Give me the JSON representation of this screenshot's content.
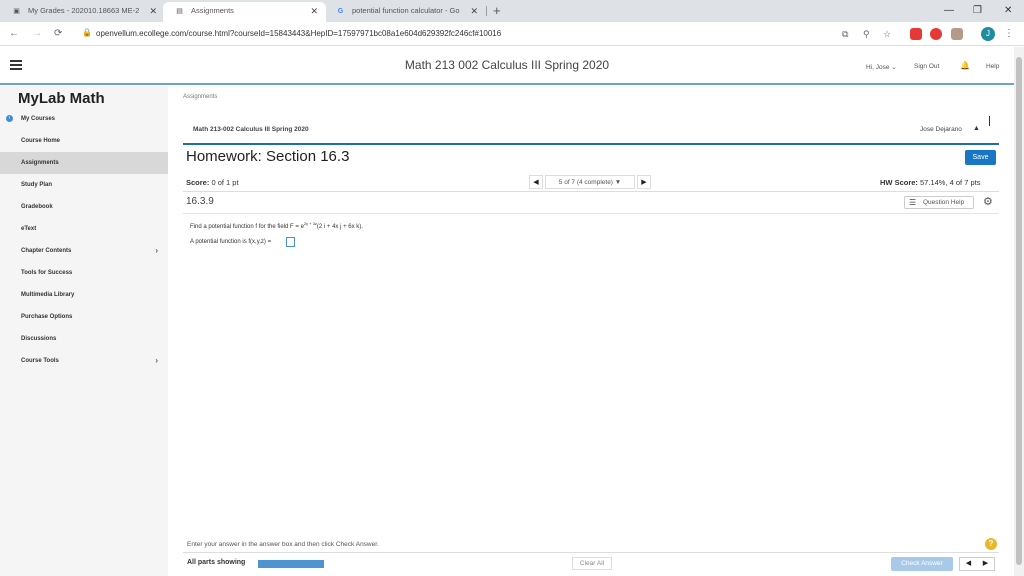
{
  "browser": {
    "tabs": [
      {
        "title": "My Grades - 202010.18663 ME-2",
        "icon": "mygrades-favicon",
        "active": false
      },
      {
        "title": "Assignments",
        "icon": "document-favicon",
        "active": true
      },
      {
        "title": "potential function calculator - Go",
        "icon": "google-favicon",
        "active": false
      }
    ],
    "favicon_glyphs": [
      "▣",
      "▤",
      "G"
    ],
    "close_glyph": "✕",
    "new_tab_glyph": "+",
    "window_controls": [
      "—",
      "❐",
      "✕"
    ],
    "url": "openvellum.ecollege.com/course.html?courseId=15843443&HepID=17597971bc08a1e604d629392fc246cf#10016",
    "nav_glyphs": {
      "back": "←",
      "forward": "→",
      "reload": "⟳",
      "lock": "🔒"
    },
    "addr_icons": [
      "⧉",
      "⚲",
      "☆"
    ],
    "profile_initial": "J",
    "menu_glyph": "⋮"
  },
  "header": {
    "course_title": "Math 213 002 Calculus III Spring 2020",
    "greeting": "Hi, Jose ⌄",
    "sign_out": "Sign Out",
    "bell_glyph": "🔔",
    "help": "Help"
  },
  "sidebar": {
    "brand": "MyLab Math",
    "items": [
      {
        "label": "My Courses",
        "has_chevron": false
      },
      {
        "label": "Course Home",
        "has_chevron": false
      },
      {
        "label": "Assignments",
        "has_chevron": false
      },
      {
        "label": "Study Plan",
        "has_chevron": false
      },
      {
        "label": "Gradebook",
        "has_chevron": false
      },
      {
        "label": "eText",
        "has_chevron": false
      },
      {
        "label": "Chapter Contents",
        "has_chevron": true
      },
      {
        "label": "Tools for Success",
        "has_chevron": false
      },
      {
        "label": "Multimedia Library",
        "has_chevron": false
      },
      {
        "label": "Purchase Options",
        "has_chevron": false
      },
      {
        "label": "Discussions",
        "has_chevron": false
      },
      {
        "label": "Course Tools",
        "has_chevron": true
      }
    ],
    "active_index": 2,
    "chevron_glyph": "›"
  },
  "main": {
    "breadcrumb": "Assignments",
    "course_sub": "Math 213-002 Calculus III Spring 2020",
    "student_name": "Jose Dejarano",
    "person_glyph": "▲",
    "hw_title": "Homework: Section 16.3",
    "save_label": "Save",
    "score_label": "Score:",
    "score_value": "0 of 1 pt",
    "question_nav": {
      "prev": "◀",
      "status": "5 of 7 (4 complete) ▼",
      "next": "▶"
    },
    "hw_score_label": "HW Score:",
    "hw_score_value": "57.14%, 4 of 7 pts",
    "question_number": "16.3.9",
    "question_help": "Question Help",
    "question_help_glyph": "☰",
    "gear_glyph": "⚙",
    "question_prefix": "Find a potential function f for the field F = e",
    "question_exponent": "2y + 3z",
    "question_suffix": "(2 i + 4x j + 6x k).",
    "answer_prompt": "A potential function is f(x,y,z) ="
  },
  "footer": {
    "hint": "Enter your answer in the answer box and then click Check Answer.",
    "help_glyph": "?",
    "parts_label": "All parts showing",
    "progress": 1.0,
    "clear_all": "Clear All",
    "check_answer": "Check Answer",
    "prev_glyph": "◀",
    "next_glyph": "▶"
  },
  "colors": {
    "accent": "#1976c5",
    "header_rule": "#6ba6c8",
    "sidebar_bg": "#f5f5f5",
    "sidebar_active": "#d8d8d8",
    "progress_fill": "#4f93d0",
    "check_answer_disabled": "#a9c9e8"
  }
}
